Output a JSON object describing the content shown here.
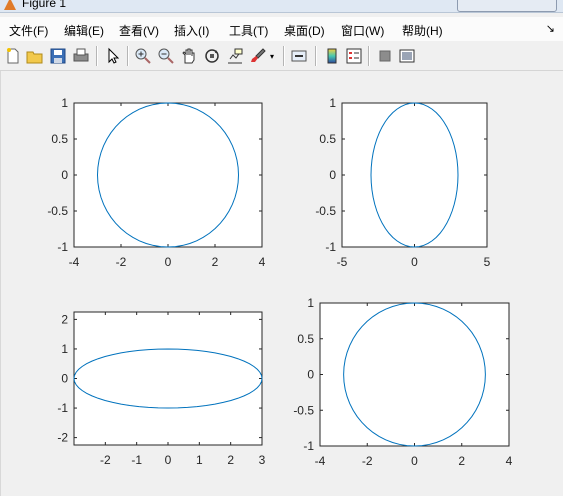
{
  "window": {
    "title": "Figure 1"
  },
  "menu": {
    "items": [
      "文件(F)",
      "编辑(E)",
      "查看(V)",
      "插入(I)",
      "工具(T)",
      "桌面(D)",
      "窗口(W)",
      "帮助(H)"
    ],
    "overflow": "↘"
  },
  "toolbar": {
    "icons": [
      "new-figure-icon",
      "open-file-icon",
      "save-icon",
      "print-icon",
      "pointer-icon",
      "zoom-in-icon",
      "zoom-out-icon",
      "pan-icon",
      "rotate-3d-icon",
      "data-cursor-icon",
      "brush-icon",
      "link-plot-icon",
      "colorbar-icon",
      "legend-icon",
      "hide-plot-tools-icon",
      "show-plot-tools-icon"
    ]
  },
  "colors": {
    "line": "#0072bd",
    "axis": "#262626",
    "figure_bg": "#f0f0f0"
  },
  "chart_data": [
    {
      "type": "line",
      "title": "",
      "xlabel": "",
      "ylabel": "",
      "series": [
        {
          "param": "ellipse",
          "a": 3,
          "b": 1,
          "points": 60
        }
      ],
      "xlim": [
        -4,
        4
      ],
      "ylim": [
        -1,
        1
      ],
      "xticks": [
        -4,
        -2,
        0,
        2,
        4
      ],
      "yticks": [
        -1,
        -0.5,
        0,
        0.5,
        1
      ],
      "xticklabels": [
        "-4",
        "-2",
        "0",
        "2",
        "4"
      ],
      "yticklabels": [
        "-1",
        "-0.5",
        "0",
        "0.5",
        "1"
      ]
    },
    {
      "type": "line",
      "title": "",
      "xlabel": "",
      "ylabel": "",
      "series": [
        {
          "param": "ellipse",
          "a": 3,
          "b": 1,
          "points": 60
        }
      ],
      "xlim": [
        -5,
        5
      ],
      "ylim": [
        -1,
        1
      ],
      "xticks": [
        -5,
        0,
        5
      ],
      "yticks": [
        -1,
        -0.5,
        0,
        0.5,
        1
      ],
      "xticklabels": [
        "-5",
        "0",
        "5"
      ],
      "yticklabels": [
        "-1",
        "-0.5",
        "0",
        "0.5",
        "1"
      ]
    },
    {
      "type": "line",
      "title": "",
      "xlabel": "",
      "ylabel": "",
      "series": [
        {
          "param": "ellipse",
          "a": 3,
          "b": 1,
          "points": 60
        }
      ],
      "xlim": [
        -3,
        3
      ],
      "ylim": [
        -2.25,
        2.25
      ],
      "xticks": [
        -2,
        -1,
        0,
        1,
        2,
        3
      ],
      "yticks": [
        -2,
        -1,
        0,
        1,
        2
      ],
      "xticklabels": [
        "-2",
        "-1",
        "0",
        "1",
        "2",
        "3"
      ],
      "yticklabels": [
        "-2",
        "-1",
        "0",
        "1",
        "2"
      ]
    },
    {
      "type": "line",
      "title": "",
      "xlabel": "",
      "ylabel": "",
      "series": [
        {
          "param": "ellipse",
          "a": 3,
          "b": 1,
          "points": 60
        }
      ],
      "xlim": [
        -4,
        4
      ],
      "ylim": [
        -1,
        1
      ],
      "xticks": [
        -4,
        -2,
        0,
        2,
        4
      ],
      "yticks": [
        -1,
        -0.5,
        0,
        0.5,
        1
      ],
      "xticklabels": [
        "-4",
        "-2",
        "0",
        "2",
        "4"
      ],
      "yticklabels": [
        "-1",
        "-0.5",
        "0",
        "0.5",
        "1"
      ]
    }
  ]
}
